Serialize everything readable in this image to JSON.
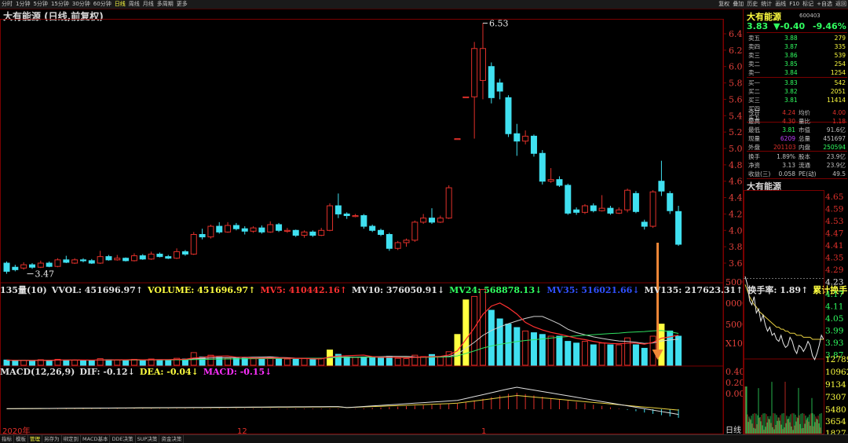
{
  "toolbar": {
    "left_items": [
      "分时",
      "1分钟",
      "5分钟",
      "15分钟",
      "30分钟",
      "60分钟",
      "日线",
      "周线",
      "月线",
      "多周期",
      "更多"
    ],
    "active": "日线",
    "right_items": [
      "复权",
      "叠加",
      "历史",
      "统计",
      "画线",
      "F10",
      "标记",
      "+自选",
      "返回"
    ]
  },
  "chart": {
    "title": "大有能源 (日线,前复权)",
    "high_annotation": "6.53",
    "low_annotation": "3.47",
    "price_axis": [
      "6.40",
      "6.20",
      "6.00",
      "5.80",
      "5.60",
      "5.40",
      "5.20",
      "5.00",
      "4.80",
      "4.60",
      "4.40",
      "4.20",
      "4.00",
      "3.80",
      "3.60"
    ],
    "volume_axis": [
      "5000",
      "0000",
      "5000",
      "X100"
    ],
    "macd_axis": [
      "0.40",
      "0.20",
      "0.00"
    ],
    "date_labels": [
      "2020年",
      "12",
      "1"
    ],
    "period_label": "日线",
    "colors": {
      "up": "#e0302a",
      "down": "#40e0f0",
      "ma_white": "#e8e8e8",
      "ma_yellow": "#e8d040",
      "arrow": "#f08838"
    }
  },
  "volume_bar": {
    "title": "135量(10)",
    "vvol": "VVOL: 451696.97↑",
    "volume": "VOLUME: 451696.97↑",
    "mv5": "MV5: 410442.16↑",
    "mv10": "MV10: 376050.91↓",
    "mv24": "MV24: 568878.13↓",
    "mv35": "MV35: 516021.66↓",
    "mv135": "MV135: 217623.31↑",
    "turnover": "换手率: 1.89↑",
    "cum_turnover": "累计换手:"
  },
  "macd_bar": {
    "title": "MACD(12,26,9)",
    "dif": "DIF: -0.12↓",
    "dea": "DEA: -0.04↓",
    "macd": "MACD: -0.15↓"
  },
  "bottom_tabs": [
    "指标",
    "模板",
    "管理",
    "另存为",
    "绑定到",
    "MACD基本",
    "DDE决策",
    "SUP决策",
    "资金决策"
  ],
  "bottom_active": "管理",
  "quote": {
    "name": "大有能源",
    "code": "600403",
    "price": "3.83",
    "change": "▼-0.40",
    "pct": "-9.46%",
    "asks": [
      {
        "label": "卖五",
        "price": "3.88",
        "vol": "279"
      },
      {
        "label": "卖四",
        "price": "3.87",
        "vol": "335"
      },
      {
        "label": "卖三",
        "price": "3.86",
        "vol": "539"
      },
      {
        "label": "卖二",
        "price": "3.85",
        "vol": "254"
      },
      {
        "label": "卖一",
        "price": "3.84",
        "vol": "1254"
      }
    ],
    "bids": [
      {
        "label": "买一",
        "price": "3.83",
        "vol": "542"
      },
      {
        "label": "买二",
        "price": "3.82",
        "vol": "2051"
      },
      {
        "label": "买三",
        "price": "3.81",
        "vol": "11414"
      },
      {
        "label": "买四",
        "price": "",
        "vol": ""
      },
      {
        "label": "买五",
        "price": "",
        "vol": ""
      }
    ],
    "stats1": [
      {
        "a": "今开",
        "b": "4.24",
        "bc": "#e0302a",
        "c": "均价",
        "d": "4.00",
        "dc": "#e0302a"
      },
      {
        "a": "最高",
        "b": "4.30",
        "bc": "#e0302a",
        "c": "量比",
        "d": "1.18",
        "dc": "#e0302a"
      },
      {
        "a": "最低",
        "b": "3.81",
        "bc": "#30ff60",
        "c": "市值",
        "d": "91.6亿",
        "dc": "#c0c0c0"
      },
      {
        "a": "现量",
        "b": "6209",
        "bc": "#c040ff",
        "c": "总量",
        "d": "451697",
        "dc": "#c0c0c0"
      },
      {
        "a": "外盘",
        "b": "201103",
        "bc": "#e0302a",
        "c": "内盘",
        "d": "250594",
        "dc": "#30ff60"
      }
    ],
    "stats2": [
      {
        "a": "换手",
        "b": "1.89%",
        "bc": "#c0c0c0",
        "c": "股本",
        "d": "23.9亿",
        "dc": "#c0c0c0"
      },
      {
        "a": "净资",
        "b": "3.13",
        "bc": "#c0c0c0",
        "c": "流通",
        "d": "23.9亿",
        "dc": "#c0c0c0"
      },
      {
        "a": "收益(三)",
        "b": "0.058",
        "bc": "#c0c0c0",
        "c": "PE(动)",
        "d": "49.5",
        "dc": "#c0c0c0"
      }
    ],
    "mini_title": "大有能源",
    "mini_price_axis": [
      {
        "v": "4.65",
        "c": "#e0302a"
      },
      {
        "v": "4.59",
        "c": "#e0302a"
      },
      {
        "v": "4.53",
        "c": "#e0302a"
      },
      {
        "v": "4.47",
        "c": "#e0302a"
      },
      {
        "v": "4.41",
        "c": "#e0302a"
      },
      {
        "v": "4.35",
        "c": "#e0302a"
      },
      {
        "v": "4.29",
        "c": "#e0302a"
      },
      {
        "v": "4.23",
        "c": "#e8e8e8"
      },
      {
        "v": "4.17",
        "c": "#30ff60"
      },
      {
        "v": "4.11",
        "c": "#30ff60"
      },
      {
        "v": "4.05",
        "c": "#30ff60"
      },
      {
        "v": "3.99",
        "c": "#30ff60"
      },
      {
        "v": "3.93",
        "c": "#30ff60"
      },
      {
        "v": "3.87",
        "c": "#30ff60"
      }
    ],
    "mini_vol_axis": [
      "12789",
      "10962",
      "9134",
      "7307",
      "5480",
      "3654",
      "1827"
    ]
  }
}
